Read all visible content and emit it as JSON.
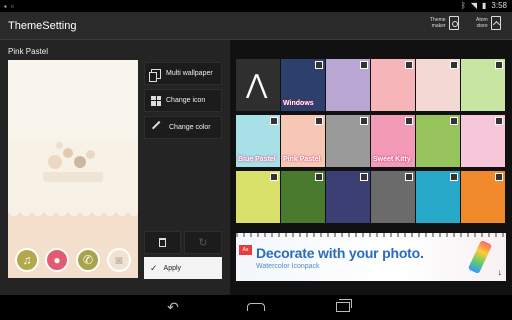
{
  "status": {
    "time": "3:58"
  },
  "app": {
    "title": "ThemeSetting"
  },
  "actions": {
    "theme_maker": [
      "Theme",
      "maker"
    ],
    "store": [
      "Atom",
      "store"
    ]
  },
  "theme": {
    "name": "Pink Pastel"
  },
  "side_buttons": {
    "multi_wallpaper": "Multi wallpaper",
    "change_icon": "Change icon",
    "change_color": "Change color",
    "apply": "Apply"
  },
  "grid_tiles": [
    {
      "name": "atom-logo-tile",
      "color": "#2f2f2f",
      "caption": ""
    },
    {
      "name": "windows-theme-tile",
      "color": "#2d3f6b",
      "caption": "Windows"
    },
    {
      "name": "lavender-owl-tile",
      "color": "#b9a6d3",
      "caption": ""
    },
    {
      "name": "bird-pastel-tile",
      "color": "#f6b6b9",
      "caption": ""
    },
    {
      "name": "red-umbrella-tile",
      "color": "#f4d8d3",
      "caption": ""
    },
    {
      "name": "green-cartoon-tile",
      "color": "#c8e6a2",
      "caption": ""
    },
    {
      "name": "blue-pastel-tile",
      "color": "#a7e0e7",
      "caption": "Blue Pastel"
    },
    {
      "name": "pink-pastel-tile",
      "color": "#f6c7b5",
      "caption": "Pink Pastel"
    },
    {
      "name": "monochrome-tile",
      "color": "#9a9a9a",
      "caption": ""
    },
    {
      "name": "sweet-kitty-tile",
      "color": "#f29ab6",
      "caption": "Sweet Kitty"
    },
    {
      "name": "green-leaf-tile",
      "color": "#96c35b",
      "caption": ""
    },
    {
      "name": "pink-bear-tile",
      "color": "#f7c6d8",
      "caption": ""
    },
    {
      "name": "yellow-hamster-tile",
      "color": "#d9e16a",
      "caption": ""
    },
    {
      "name": "white-tulip-tile",
      "color": "#4a7a2e",
      "caption": ""
    },
    {
      "name": "crocodile-tile",
      "color": "#3b3f74",
      "caption": ""
    },
    {
      "name": "grey-drops-tile",
      "color": "#6b6b6b",
      "caption": ""
    },
    {
      "name": "aqua-tile",
      "color": "#29a9c9",
      "caption": ""
    },
    {
      "name": "orange-bird-tile",
      "color": "#f18a2b",
      "caption": ""
    }
  ],
  "banner": {
    "headline": "Decorate with your photo.",
    "sub": "Watercolor Iconpack",
    "logo": "As"
  }
}
